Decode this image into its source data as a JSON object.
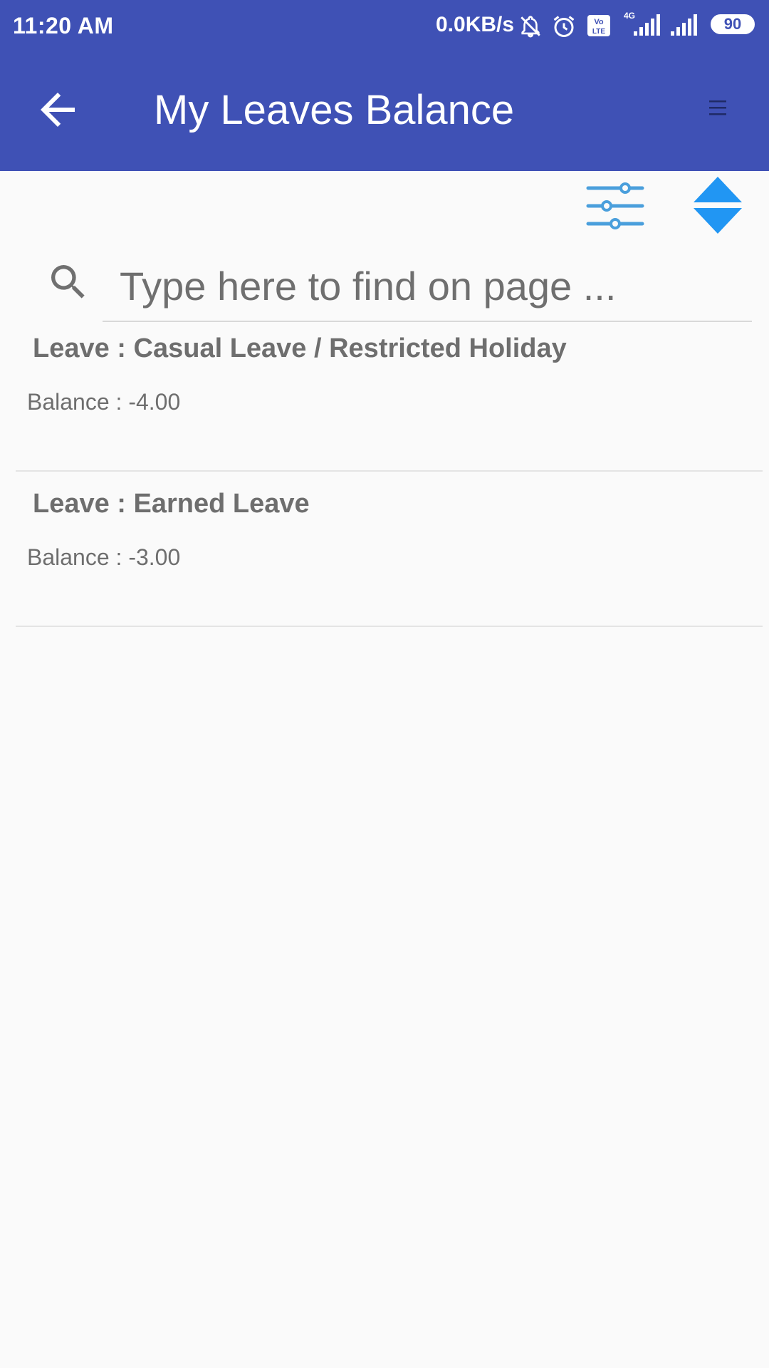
{
  "status_bar": {
    "time": "11:20 AM",
    "network_speed": "0.0KB/s",
    "battery_level": "90",
    "volte_label": "Vo LTE",
    "network_type": "4G",
    "icons": [
      "bell-off-icon",
      "alarm-icon",
      "volte-icon",
      "signal-icon",
      "signal-icon",
      "battery-icon"
    ]
  },
  "app_bar": {
    "title": "My Leaves Balance",
    "back_icon": "arrow-back-icon",
    "menu_icon": "menu-icon"
  },
  "toolbar": {
    "filter_icon": "sliders-icon",
    "sort_icon": "sort-updown-icon"
  },
  "search": {
    "placeholder": "Type here to find on page ...",
    "value": ""
  },
  "leaves": [
    {
      "title": "Leave : Casual Leave / Restricted Holiday",
      "balance": "Balance : -4.00"
    },
    {
      "title": "Leave : Earned Leave",
      "balance": "Balance : -3.00"
    }
  ],
  "colors": {
    "primary": "#3f51b5",
    "accent": "#2196f3",
    "text": "#6e6e6e",
    "background": "#fafafa"
  }
}
